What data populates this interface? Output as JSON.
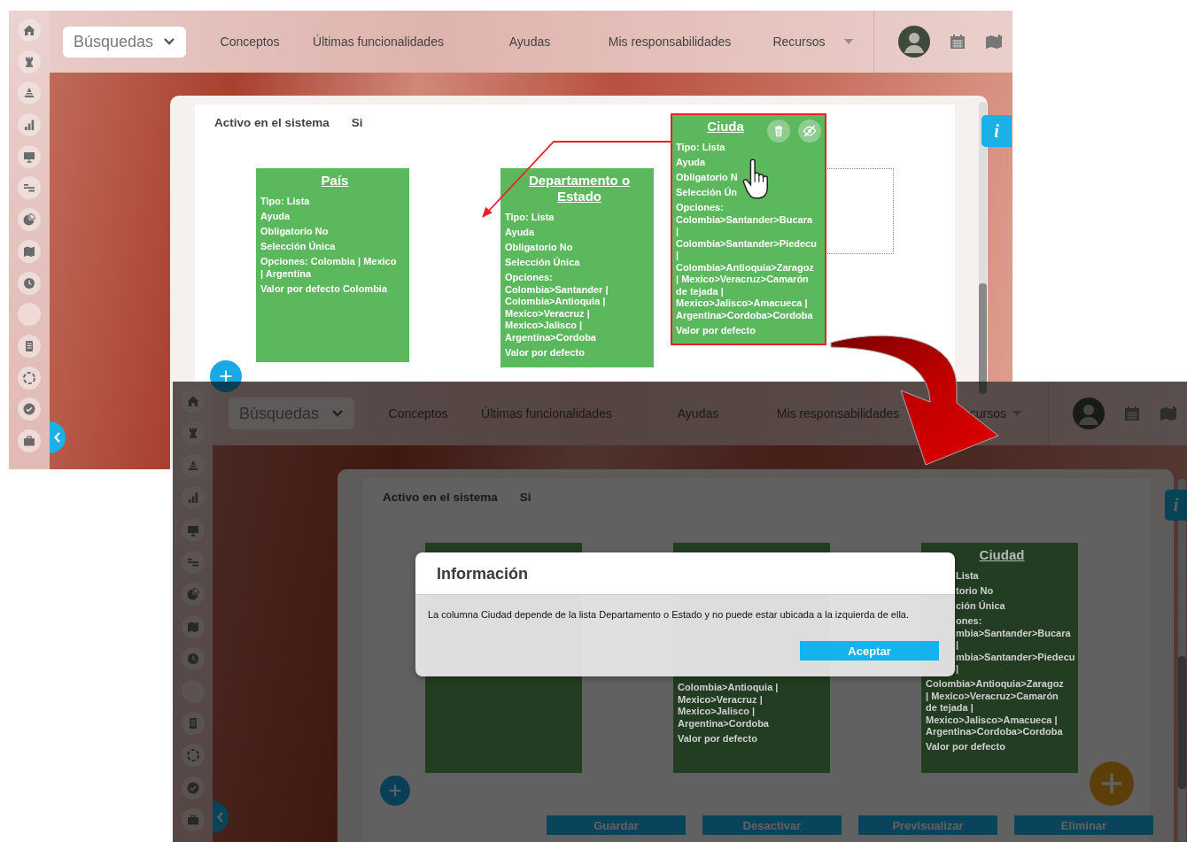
{
  "screens": [
    {
      "kind": "editor",
      "search": "Búsquedas",
      "nav": [
        "Conceptos",
        "Últimas funcionalidades",
        "Ayudas",
        "Mis responsabilidades",
        "Recursos"
      ],
      "field": {
        "label": "Activo en el sistema",
        "value": "Si"
      },
      "cards": [
        {
          "title": "País",
          "selected": false,
          "items": [
            [
              "Tipo: Lista"
            ],
            [
              "Ayuda"
            ],
            [
              "Obligatorio No"
            ],
            [
              "Selección Única"
            ],
            [
              "Opciones: Colombia | Mexico",
              "| Argentina"
            ],
            [
              "Valor por defecto Colombia"
            ]
          ]
        },
        {
          "title": "Departamento o Estado",
          "selected": false,
          "items": [
            [
              "Tipo: Lista"
            ],
            [
              "Ayuda"
            ],
            [
              "Obligatorio No"
            ],
            [
              "Selección Única"
            ],
            [
              "Opciones:",
              "Colombia>Santander |",
              "Colombia>Antioquia |",
              "Mexico>Veracruz |",
              "Mexico>Jalisco |",
              "Argentina>Cordoba"
            ],
            [
              "Valor por defecto"
            ]
          ]
        },
        {
          "title": "Ciuda",
          "selected": true,
          "items": [
            [
              "Tipo: Lista"
            ],
            [
              "Ayuda"
            ],
            [
              "Obligatorio N"
            ],
            [
              "Selección Ún"
            ],
            [
              "Opciones:",
              "Colombia>Santander>Bucara",
              "|",
              "Colombia>Santander>Piedecu",
              "|",
              "Colombia>Antioquia>Zaragoz",
              "| Mexico>Veracruz>Camarón",
              "de tejada |",
              "Mexico>Jalisco>Amacueca |",
              "Argentina>Cordoba>Cordoba"
            ],
            [
              "Valor por defecto"
            ]
          ]
        }
      ],
      "info": "i"
    },
    {
      "kind": "dialog",
      "search": "Búsquedas",
      "nav": [
        "Conceptos",
        "Últimas funcionalidades",
        "Ayudas",
        "Mis responsabilidades",
        "cursos"
      ],
      "field": {
        "label": "Activo en el sistema",
        "value": "Si"
      },
      "cards": [
        {
          "selected": false
        },
        {
          "selected": false,
          "items": [
            [
              "Colombia>Antioquia |",
              "Mexico>Veracruz |",
              "Mexico>Jalisco |",
              "Argentina>Cordoba"
            ],
            [
              "Valor por defecto"
            ]
          ]
        },
        {
          "title": "Ciudad",
          "selected": false,
          "clipped": [
            [
              "Lista"
            ],
            [
              "torio No"
            ],
            [
              "ción Única"
            ],
            [
              "ones:",
              "mbia>Santander>Bucara",
              "|",
              "mbia>Santander>Piedecu",
              "|"
            ]
          ],
          "items": [
            [
              "Colombia>Antioquia>Zaragoz",
              "| Mexico>Veracruz>Camarón",
              "de tejada |",
              "Mexico>Jalisco>Amacueca |",
              "Argentina>Cordoba>Cordoba"
            ],
            [
              "Valor por defecto"
            ]
          ]
        }
      ],
      "info": "i",
      "buttons": [
        "Guardar",
        "Desactivar",
        "Previsualizar",
        "Eliminar"
      ],
      "dialog": {
        "title": "Información",
        "message": "La columna Ciudad depende de la lista Departamento o Estado y no puede estar ubicada a la izquierda de ella.",
        "button": "Aceptar"
      }
    }
  ]
}
